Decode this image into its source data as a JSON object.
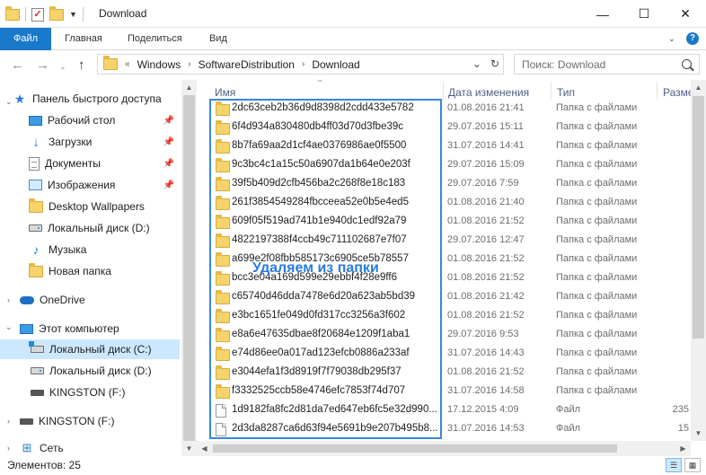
{
  "window": {
    "title": "Download",
    "minimize": "—",
    "maximize": "☐",
    "close": "✕"
  },
  "ribbon": {
    "tabs": [
      "Файл",
      "Главная",
      "Поделиться",
      "Вид"
    ]
  },
  "address": {
    "prefix": "«",
    "crumbs": [
      "Windows",
      "SoftwareDistribution",
      "Download"
    ],
    "dropdown": "⌄",
    "refresh": "↻"
  },
  "search": {
    "placeholder": "Поиск: Download"
  },
  "nav": {
    "quick_access": "Панель быстрого доступа",
    "desktop": "Рабочий стол",
    "downloads": "Загрузки",
    "documents": "Документы",
    "images": "Изображения",
    "desktop_wallpapers": "Desktop Wallpapers",
    "local_d": "Локальный диск (D:)",
    "music": "Музыка",
    "new_folder": "Новая папка",
    "onedrive": "OneDrive",
    "this_pc": "Этот компьютер",
    "local_c": "Локальный диск (C:)",
    "local_d2": "Локальный диск (D:)",
    "kingston1": "KINGSTON (F:)",
    "kingston2": "KINGSTON (F:)",
    "network": "Сеть"
  },
  "columns": {
    "name": "Имя",
    "date": "Дата изменения",
    "type": "Тип",
    "size": "Разме"
  },
  "rows": [
    {
      "name": "2dc63ceb2b36d9d8398d2cdd433e5782",
      "date": "01.08.2016 21:41",
      "type": "Папка с файлами",
      "size": "",
      "kind": "folder"
    },
    {
      "name": "6f4d934a830480db4ff03d70d3fbe39c",
      "date": "29.07.2016 15:11",
      "type": "Папка с файлами",
      "size": "",
      "kind": "folder"
    },
    {
      "name": "8b7fa69aa2d1cf4ae0376986ae0f5500",
      "date": "31.07.2016 14:41",
      "type": "Папка с файлами",
      "size": "",
      "kind": "folder"
    },
    {
      "name": "9c3bc4c1a15c50a6907da1b64e0e203f",
      "date": "29.07.2016 15:09",
      "type": "Папка с файлами",
      "size": "",
      "kind": "folder"
    },
    {
      "name": "39f5b409d2cfb456ba2c268f8e18c183",
      "date": "29.07.2016 7:59",
      "type": "Папка с файлами",
      "size": "",
      "kind": "folder"
    },
    {
      "name": "261f3854549284fbcceea52e0b5e4ed5",
      "date": "01.08.2016 21:40",
      "type": "Папка с файлами",
      "size": "",
      "kind": "folder"
    },
    {
      "name": "609f05f519ad741b1e940dc1edf92a79",
      "date": "01.08.2016 21:52",
      "type": "Папка с файлами",
      "size": "",
      "kind": "folder"
    },
    {
      "name": "4822197388f4ccb49c711102687e7f07",
      "date": "29.07.2016 12:47",
      "type": "Папка с файлами",
      "size": "",
      "kind": "folder"
    },
    {
      "name": "a699e2f08fbb585173c6905ce5b78557",
      "date": "01.08.2016 21:52",
      "type": "Папка с файлами",
      "size": "",
      "kind": "folder"
    },
    {
      "name": "bcc3e04a169d599e29ebbf4f28e9ff6",
      "date": "01.08.2016 21:52",
      "type": "Папка с файлами",
      "size": "",
      "kind": "folder"
    },
    {
      "name": "c65740d46dda7478e6d20a623ab5bd39",
      "date": "01.08.2016 21:42",
      "type": "Папка с файлами",
      "size": "",
      "kind": "folder"
    },
    {
      "name": "e3bc1651fe049d0fd317cc3256a3f602",
      "date": "01.08.2016 21:52",
      "type": "Папка с файлами",
      "size": "",
      "kind": "folder"
    },
    {
      "name": "e8a6e47635dbae8f20684e1209f1aba1",
      "date": "29.07.2016 9:53",
      "type": "Папка с файлами",
      "size": "",
      "kind": "folder"
    },
    {
      "name": "e74d86ee0a017ad123efcb0886a233af",
      "date": "31.07.2016 14:43",
      "type": "Папка с файлами",
      "size": "",
      "kind": "folder"
    },
    {
      "name": "e3044efa1f3d8919f7f79038db295f37",
      "date": "01.08.2016 21:52",
      "type": "Папка с файлами",
      "size": "",
      "kind": "folder"
    },
    {
      "name": "f3332525ccb58e4746efc7853f74d707",
      "date": "31.07.2016 14:58",
      "type": "Папка с файлами",
      "size": "",
      "kind": "folder"
    },
    {
      "name": "1d9182fa8fc2d81da7ed647eb6fc5e32d990...",
      "date": "17.12.2015 4:09",
      "type": "Файл",
      "size": "235",
      "kind": "file"
    },
    {
      "name": "2d3da8287ca6d63f94e5691b9e207b495b8...",
      "date": "31.07.2016 14:53",
      "type": "Файл",
      "size": "15",
      "kind": "file"
    }
  ],
  "overlay": {
    "text": "Удаляем из папки"
  },
  "status": {
    "items": "Элементов: 25"
  },
  "colors": {
    "accent": "#1979ca",
    "selection": "#cce8ff",
    "highlight_border": "#3a86d8",
    "overlay_text": "#2a7be0"
  }
}
